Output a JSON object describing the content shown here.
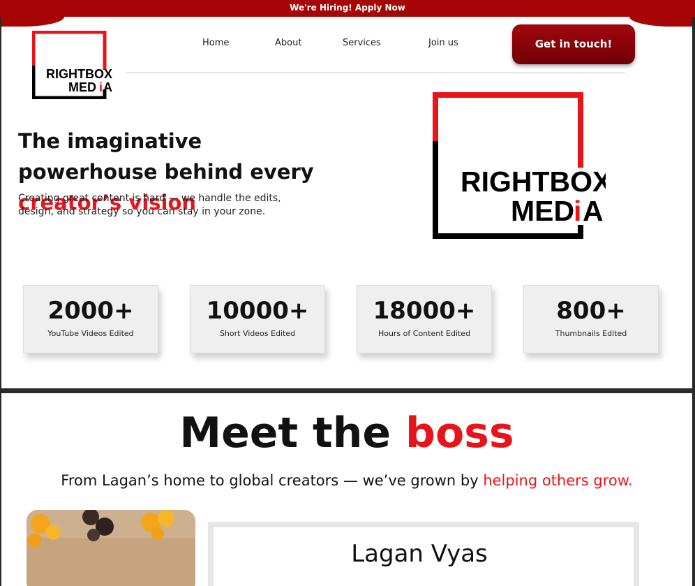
{
  "banner": {
    "text": "We're Hiring! Apply Now"
  },
  "brand": {
    "line1": "RIGHTBOX",
    "line2_a": "MED",
    "line2_b": "i",
    "line2_c": "A"
  },
  "nav": {
    "items": [
      "Home",
      "About",
      "Services",
      "Join us"
    ],
    "cta": "Get in touch!"
  },
  "hero": {
    "headline_main": "The imaginative powerhouse behind every ",
    "headline_accent": "creator’s vision",
    "subtext": "Creating great content is hard — we handle the edits, design, and strategy so you can stay in your zone."
  },
  "stats": [
    {
      "value": "2000+",
      "label": "YouTube Videos Edited"
    },
    {
      "value": "10000+",
      "label": "Short Videos Edited"
    },
    {
      "value": "18000+",
      "label": "Hours of Content Edited"
    },
    {
      "value": "800+",
      "label": "Thumbnails Edited"
    }
  ],
  "boss": {
    "title_main": "Meet the ",
    "title_accent": "boss",
    "sub_main": "From Lagan’s home to global creators — we’ve grown by ",
    "sub_accent": "helping others grow.",
    "name": "Lagan Vyas"
  },
  "colors": {
    "brand_red": "#e8141a",
    "banner_red": "#a50505",
    "cta_red": "#8a0308"
  }
}
